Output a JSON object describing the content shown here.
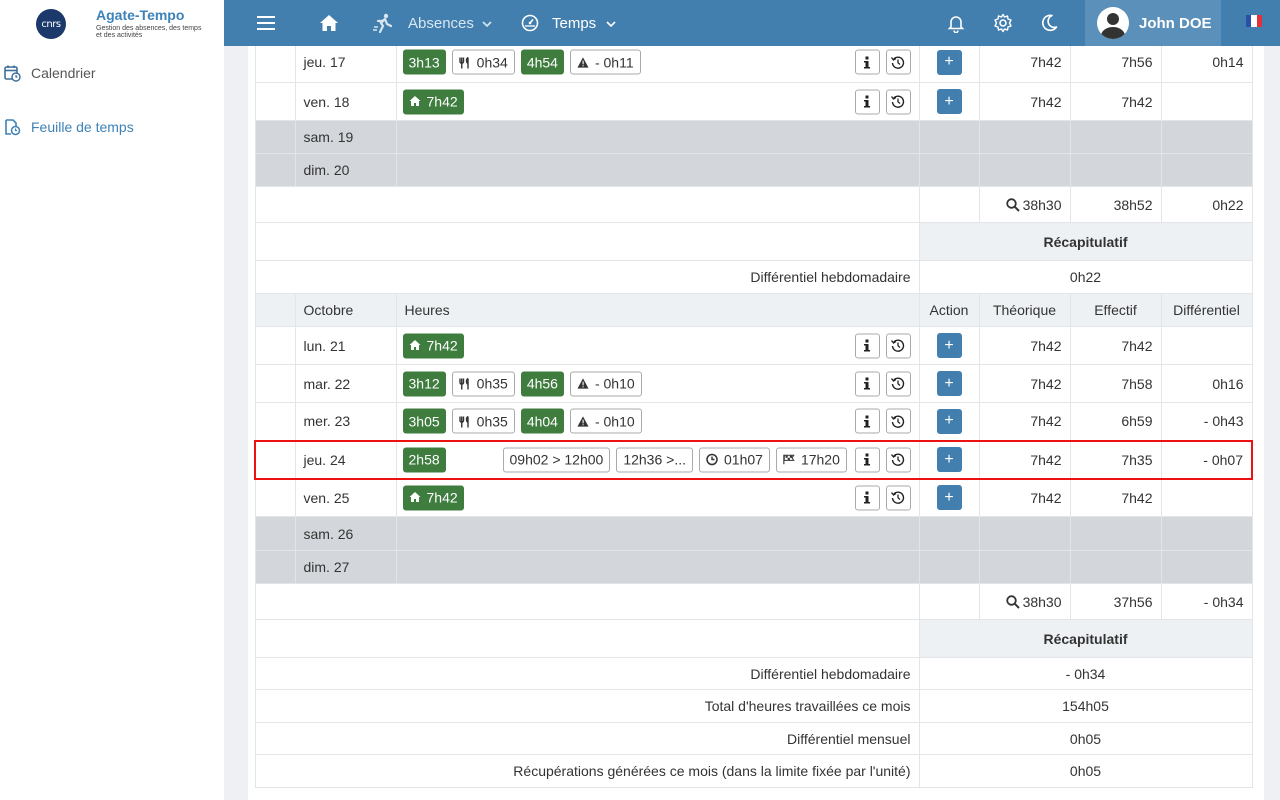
{
  "app": {
    "name": "Agate-Tempo",
    "subtitle": "Gestion des absences, des temps et des activités",
    "logo_text": "cnrs"
  },
  "sidebar": {
    "items": [
      {
        "label": "Calendrier"
      },
      {
        "label": "Feuille de temps"
      }
    ]
  },
  "header": {
    "menu_absences": "Absences",
    "menu_temps": "Temps",
    "user_name": "John DOE"
  },
  "colors": {
    "header": "#437fae",
    "accent": "#3d82b8",
    "green_chip": "#3f7d3f",
    "selection": "#ee1111"
  },
  "week1": {
    "rows": [
      {
        "day": "jeu. 17",
        "chips": [
          {
            "t": "3h13",
            "s": "g"
          },
          {
            "t": "0h34",
            "s": "w",
            "icon": "utensils-icon"
          },
          {
            "t": "4h54",
            "s": "g"
          },
          {
            "t": "- 0h11",
            "s": "w",
            "icon": "warning-icon"
          }
        ],
        "theo": "7h42",
        "eff": "7h56",
        "diff": "0h14"
      },
      {
        "day": "ven. 18",
        "chips": [
          {
            "t": "7h42",
            "s": "g",
            "icon": "home-icon"
          }
        ],
        "theo": "7h42",
        "eff": "7h42",
        "diff": ""
      }
    ],
    "weekend": [
      "sam. 19",
      "dim. 20"
    ],
    "total": {
      "theo": "38h30",
      "eff": "38h52",
      "diff": "0h22"
    },
    "recap_title": "Récapitulatif",
    "recap": [
      {
        "label": "Différentiel hebdomadaire",
        "value": "0h22"
      }
    ]
  },
  "columns": {
    "month": "Octobre",
    "hours": "Heures",
    "action": "Action",
    "theo": "Théorique",
    "eff": "Effectif",
    "diff": "Différentiel"
  },
  "week2": {
    "rows": [
      {
        "day": "lun. 21",
        "chips": [
          {
            "t": "7h42",
            "s": "g",
            "icon": "home-icon"
          }
        ],
        "theo": "7h42",
        "eff": "7h42",
        "diff": ""
      },
      {
        "day": "mar. 22",
        "chips": [
          {
            "t": "3h12",
            "s": "g"
          },
          {
            "t": "0h35",
            "s": "w",
            "icon": "utensils-icon"
          },
          {
            "t": "4h56",
            "s": "g"
          },
          {
            "t": "- 0h10",
            "s": "w",
            "icon": "warning-icon"
          }
        ],
        "theo": "7h42",
        "eff": "7h58",
        "diff": "0h16"
      },
      {
        "day": "mer. 23",
        "chips": [
          {
            "t": "3h05",
            "s": "g"
          },
          {
            "t": "0h35",
            "s": "w",
            "icon": "utensils-icon"
          },
          {
            "t": "4h04",
            "s": "g"
          },
          {
            "t": "- 0h10",
            "s": "w",
            "icon": "warning-icon"
          }
        ],
        "theo": "7h42",
        "eff": "6h59",
        "diff": "- 0h43"
      },
      {
        "day": "jeu. 24",
        "selected": true,
        "chips": [
          {
            "t": "2h58",
            "s": "g"
          }
        ],
        "chips_right": [
          {
            "t": "09h02 > 12h00",
            "s": "w"
          },
          {
            "t": "12h36 >...",
            "s": "w"
          },
          {
            "t": "01h07",
            "s": "w",
            "icon": "clock-icon"
          },
          {
            "t": "17h20",
            "s": "w",
            "icon": "flag-icon"
          }
        ],
        "theo": "7h42",
        "eff": "7h35",
        "diff": "- 0h07"
      },
      {
        "day": "ven. 25",
        "chips": [
          {
            "t": "7h42",
            "s": "g",
            "icon": "home-icon"
          }
        ],
        "theo": "7h42",
        "eff": "7h42",
        "diff": ""
      }
    ],
    "weekend": [
      "sam. 26",
      "dim. 27"
    ],
    "total": {
      "theo": "38h30",
      "eff": "37h56",
      "diff": "- 0h34"
    },
    "recap_title": "Récapitulatif",
    "recap": [
      {
        "label": "Différentiel hebdomadaire",
        "value": "- 0h34"
      },
      {
        "label": "Total d'heures travaillées ce mois",
        "value": "154h05"
      },
      {
        "label": "Différentiel mensuel",
        "value": "0h05"
      },
      {
        "label": "Récupérations générées ce mois (dans la limite fixée par l'unité)",
        "value": "0h05"
      }
    ]
  }
}
